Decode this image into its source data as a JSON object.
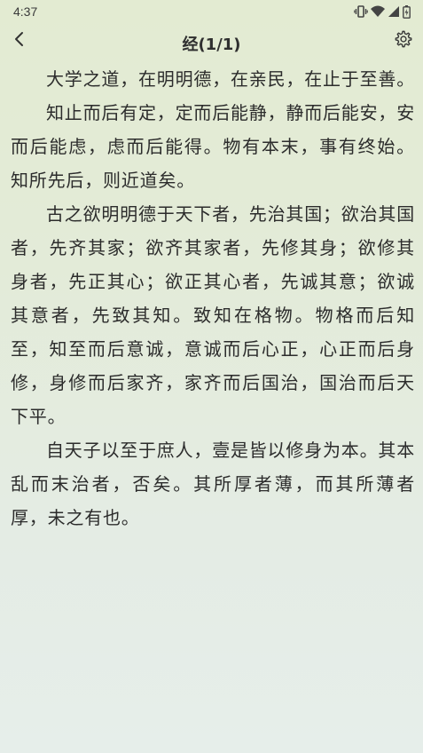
{
  "status_bar": {
    "time": "4:37",
    "icons": [
      "vibrate-icon",
      "wifi-icon",
      "signal-icon",
      "battery-icon"
    ]
  },
  "app_bar": {
    "title": "经(1/1)",
    "back_icon": "chevron-left-icon",
    "settings_icon": "gear-icon"
  },
  "content": {
    "paragraphs": [
      "大学之道，在明明德，在亲民，在止于至善。",
      "知止而后有定，定而后能静，静而后能安，安而后能虑，虑而后能得。物有本末，事有终始。知所先后，则近道矣。",
      "古之欲明明德于天下者，先治其国；欲治其国者，先齐其家；欲齐其家者，先修其身；欲修其身者，先正其心；欲正其心者，先诚其意；欲诚其意者，先致其知。致知在格物。物格而后知至，知至而后意诚，意诚而后心正，心正而后身修，身修而后家齐，家齐而后国治，国治而后天下平。",
      "自天子以至于庶人，壹是皆以修身为本。其本乱而末治者，否矣。其所厚者薄，而其所薄者厚，未之有也。"
    ]
  },
  "colors": {
    "background_top": "#e3ebd2",
    "background_bottom": "#e6eeea",
    "text": "#2c2c2c"
  }
}
